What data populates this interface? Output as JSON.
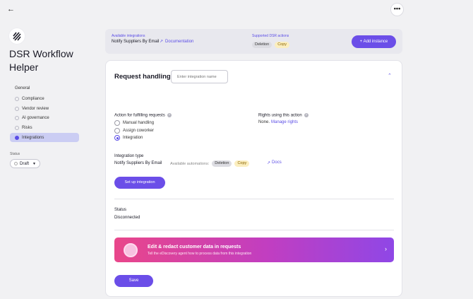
{
  "header": {
    "back_icon": "arrow-left-icon",
    "more_icon": "more-horizontal-icon",
    "more_glyph": "•••"
  },
  "app": {
    "title": "DSR Workflow Helper",
    "logo_icon": "striped-logo-icon"
  },
  "sidebar": {
    "heading": "General",
    "items": [
      {
        "label": "Compliance",
        "icon": "check-circle-icon",
        "active": false
      },
      {
        "label": "Vendor review",
        "icon": "vendor-icon",
        "active": false
      },
      {
        "label": "AI governance",
        "icon": "ai-icon",
        "active": false
      },
      {
        "label": "Risks",
        "icon": "risk-icon",
        "active": false
      },
      {
        "label": "Integrations",
        "icon": "plug-icon",
        "active": true
      }
    ],
    "status_label": "Status",
    "status_value": "Draft"
  },
  "topbar": {
    "available_label": "Available integrations",
    "integration_name": "Notify Suppliers By Email",
    "docs_link": "Documentation",
    "supported_label": "Supported DSR actions",
    "actions": [
      "Deletion",
      "Copy"
    ],
    "add_button": "+ Add instance"
  },
  "card": {
    "title": "Request handling",
    "name_placeholder": "Enter integration name",
    "action_label": "Action for fulfilling requests",
    "options": [
      {
        "label": "Manual handling",
        "selected": false
      },
      {
        "label": "Assign coworker",
        "selected": false
      },
      {
        "label": "Integration",
        "selected": true
      }
    ],
    "rights_label": "Rights using this action",
    "rights_none": "None.",
    "rights_link": "Manage rights",
    "type_label": "Integration type",
    "type_value": "Notify Suppliers By Email",
    "automations_label": "Available automations:",
    "automations": [
      "Deletion",
      "Copy"
    ],
    "docs_link": "Docs",
    "setup_button": "Set up integration",
    "status_label": "Status",
    "status_value": "Disconnected",
    "banner_title": "Edit & redact customer data in requests",
    "banner_subtitle": "Tell the eDiscovery agent how to process data from this integration",
    "save_button": "Save"
  },
  "colors": {
    "accent": "#6b4ee8",
    "active_nav": "#cbcdf3",
    "banner_start": "#e9468a",
    "banner_end": "#8f47e6"
  }
}
